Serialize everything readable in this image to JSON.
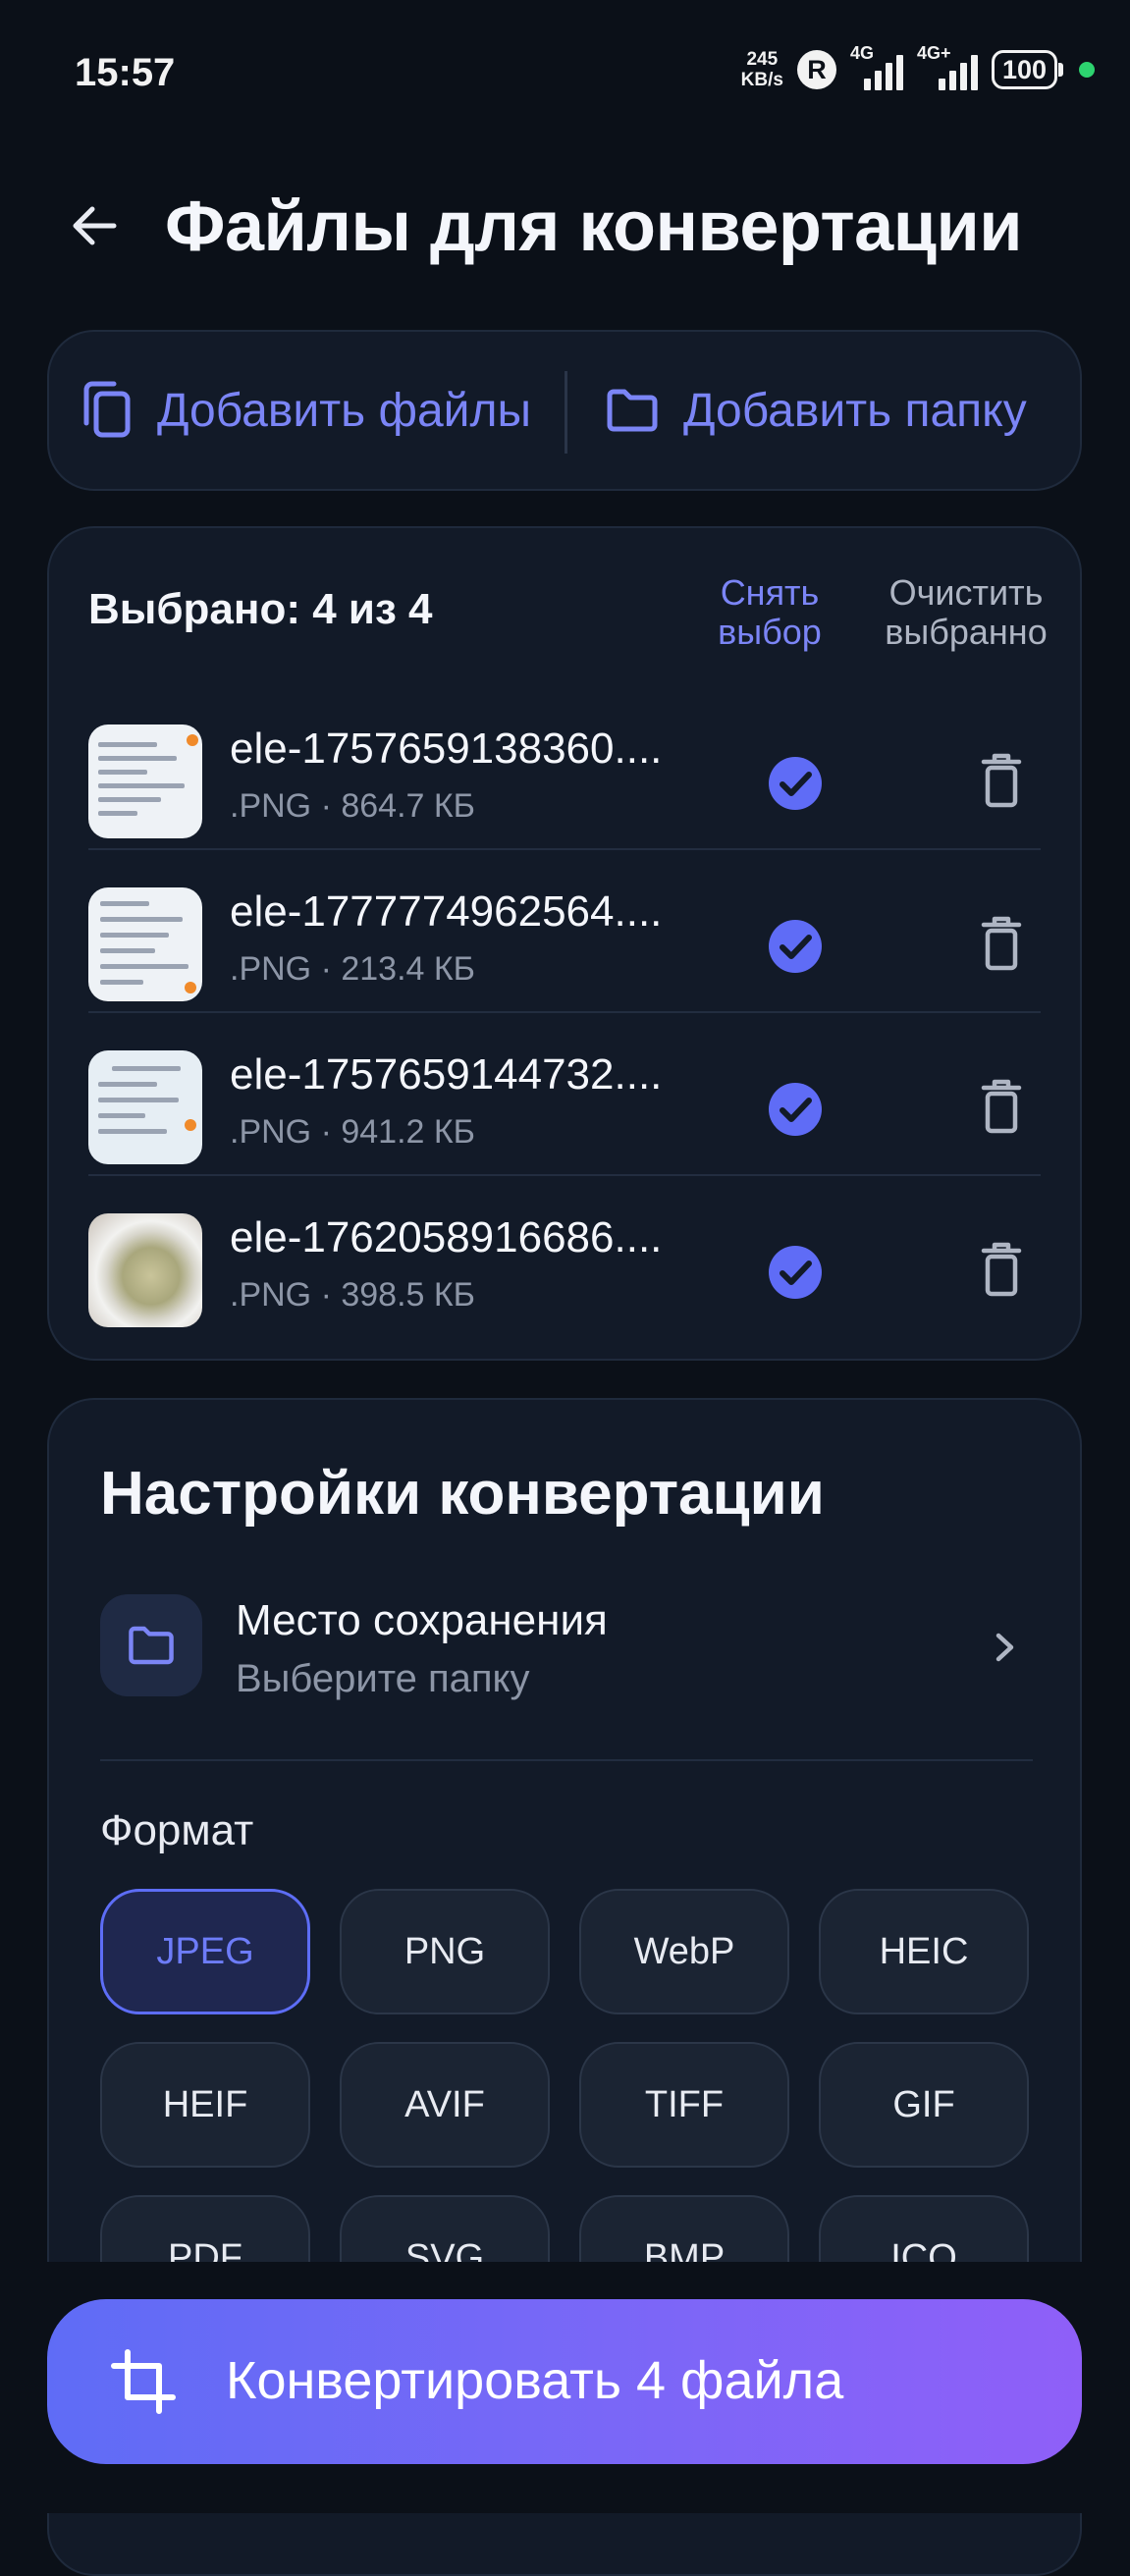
{
  "status_bar": {
    "time": "15:57",
    "speed_value": "245",
    "speed_unit": "KB/s",
    "r_badge": "R",
    "network1": "4G",
    "network2": "4G+",
    "battery": "100"
  },
  "header": {
    "title": "Файлы для конвертации"
  },
  "add_bar": {
    "add_files": "Добавить файлы",
    "add_folder": "Добавить папку"
  },
  "selection": {
    "count_label": "Выбрано: 4 из 4",
    "deselect": "Снять выбор",
    "clear_selected": "Очистить выбранно"
  },
  "files": [
    {
      "name": "ele-1757659138360....",
      "meta": ".PNG · 864.7 КБ",
      "checked": true
    },
    {
      "name": "ele-1777774962564....",
      "meta": ".PNG · 213.4 КБ",
      "checked": true
    },
    {
      "name": "ele-1757659144732....",
      "meta": ".PNG · 941.2 КБ",
      "checked": true
    },
    {
      "name": "ele-1762058916686....",
      "meta": ".PNG · 398.5 КБ",
      "checked": true
    }
  ],
  "settings": {
    "title": "Настройки конвертации",
    "save_location": {
      "title": "Место сохранения",
      "subtitle": "Выберите папку"
    },
    "format_label": "Формат",
    "formats": [
      "JPEG",
      "PNG",
      "WebP",
      "HEIC",
      "HEIF",
      "AVIF",
      "TIFF",
      "GIF",
      "PDF",
      "SVG",
      "BMP",
      "ICO"
    ],
    "selected_format": "JPEG"
  },
  "convert_button": {
    "label": "Конвертировать 4 файла"
  },
  "colors": {
    "background": "#0b1018",
    "card": "#121a28",
    "accent": "#7b85f6",
    "check": "#5f6cf6"
  }
}
